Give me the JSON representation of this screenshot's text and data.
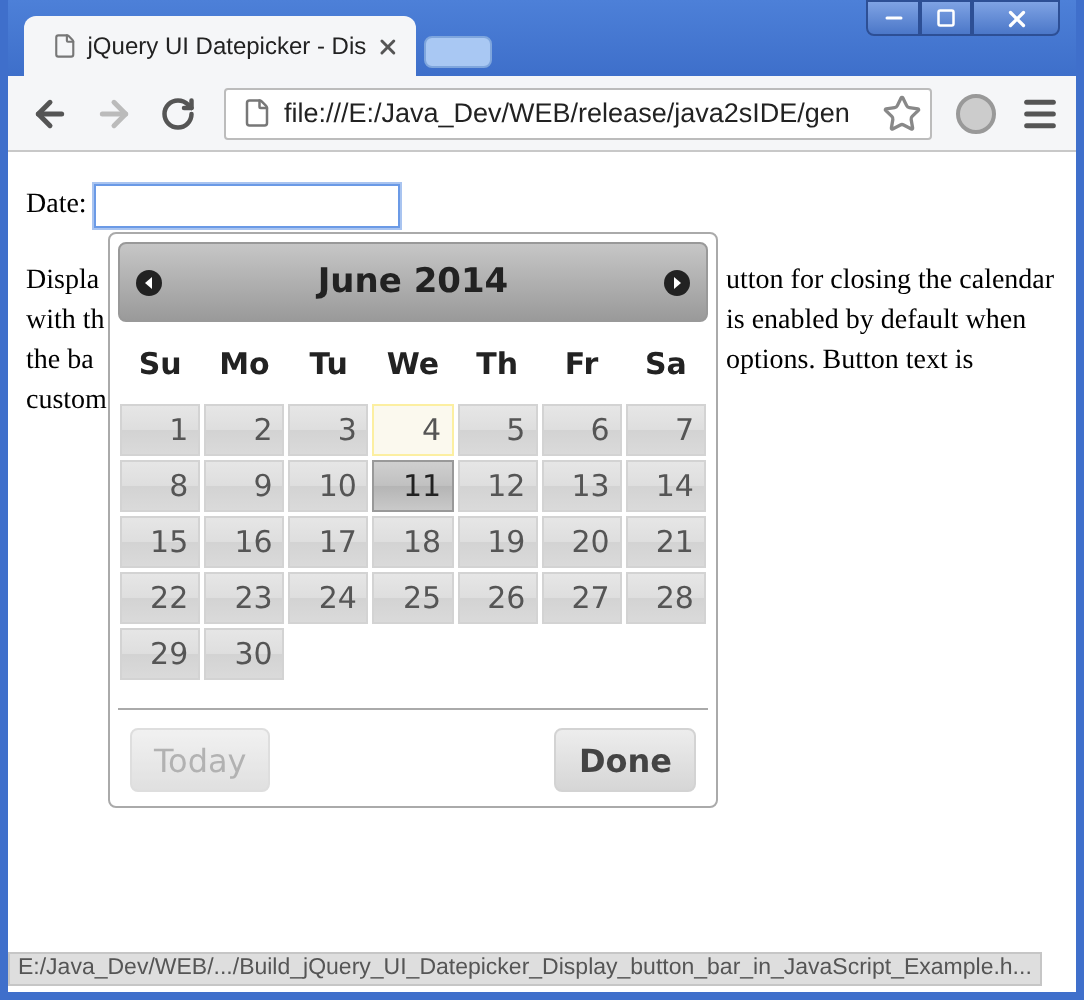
{
  "window": {
    "tab": {
      "title": "jQuery UI Datepicker - Dis",
      "selected": true
    }
  },
  "toolbar": {
    "nav": [
      {
        "kind": "back",
        "disabled": false
      },
      {
        "kind": "forward",
        "disabled": true
      },
      {
        "kind": "reload",
        "disabled": false
      }
    ],
    "address": "file:///E:/Java_Dev/WEB/release/java2sIDE/gen"
  },
  "form": {
    "label": "Date:"
  },
  "paragraph_lines": [
    {
      "left": "Displa",
      "right": "utton for closing the calendar"
    },
    {
      "left": "with th",
      "right": "is enabled by default when"
    },
    {
      "left": "the ba",
      "right": "options. Button text is"
    },
    {
      "left": "custom"
    }
  ],
  "datepicker": {
    "title": "June 2014",
    "weekdays": [
      "Su",
      "Mo",
      "Tu",
      "We",
      "Th",
      "Fr",
      "Sa"
    ],
    "weeks": [
      [
        {
          "label": "1",
          "today": false,
          "selected": false
        },
        {
          "label": "2",
          "today": false,
          "selected": false
        },
        {
          "label": "3",
          "today": false,
          "selected": false
        },
        {
          "label": "4",
          "today": true,
          "selected": false
        },
        {
          "label": "5",
          "today": false,
          "selected": false
        },
        {
          "label": "6",
          "today": false,
          "selected": false
        },
        {
          "label": "7",
          "today": false,
          "selected": false
        }
      ],
      [
        {
          "label": "8",
          "today": false,
          "selected": false
        },
        {
          "label": "9",
          "today": false,
          "selected": false
        },
        {
          "label": "10",
          "today": false,
          "selected": false
        },
        {
          "label": "11",
          "today": false,
          "selected": true
        },
        {
          "label": "12",
          "today": false,
          "selected": false
        },
        {
          "label": "13",
          "today": false,
          "selected": false
        },
        {
          "label": "14",
          "today": false,
          "selected": false
        }
      ],
      [
        {
          "label": "15",
          "today": false,
          "selected": false
        },
        {
          "label": "16",
          "today": false,
          "selected": false
        },
        {
          "label": "17",
          "today": false,
          "selected": false
        },
        {
          "label": "18",
          "today": false,
          "selected": false
        },
        {
          "label": "19",
          "today": false,
          "selected": false
        },
        {
          "label": "20",
          "today": false,
          "selected": false
        },
        {
          "label": "21",
          "today": false,
          "selected": false
        }
      ],
      [
        {
          "label": "22",
          "today": false,
          "selected": false
        },
        {
          "label": "23",
          "today": false,
          "selected": false
        },
        {
          "label": "24",
          "today": false,
          "selected": false
        },
        {
          "label": "25",
          "today": false,
          "selected": false
        },
        {
          "label": "26",
          "today": false,
          "selected": false
        },
        {
          "label": "27",
          "today": false,
          "selected": false
        },
        {
          "label": "28",
          "today": false,
          "selected": false
        }
      ],
      [
        {
          "label": "29",
          "today": false,
          "selected": false
        },
        {
          "label": "30",
          "today": false,
          "selected": false
        }
      ]
    ],
    "buttons": [
      {
        "label": "Today",
        "kind": "secondary"
      },
      {
        "label": "Done",
        "kind": "primary"
      }
    ]
  },
  "status_bar": "E:/Java_Dev/WEB/.../Build_jQuery_UI_Datepicker_Display_button_bar_in_JavaScript_Example.h..."
}
